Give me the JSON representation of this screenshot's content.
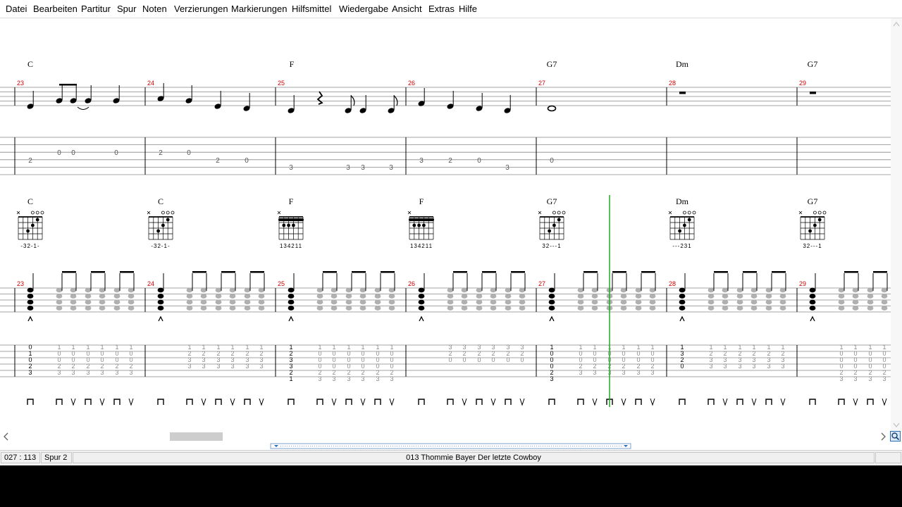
{
  "menu": [
    "Datei",
    "Bearbeiten",
    "Partitur",
    "Spur",
    "Noten",
    "Verzierungen",
    "Markierungen",
    "Hilfsmittel",
    "Wiedergabe",
    "Ansicht",
    "Extras",
    "Hilfe"
  ],
  "system1": {
    "chords": [
      "C",
      "F",
      "G7",
      "Dm",
      "G7"
    ],
    "measures": [
      "23",
      "24",
      "25",
      "26",
      "27",
      "28",
      "29"
    ],
    "tab_numbers": [
      "2",
      "0",
      "0",
      "0",
      "2",
      "0",
      "2",
      "0",
      "3",
      "3",
      "3",
      "3",
      "3",
      "2",
      "0",
      "3",
      "0"
    ]
  },
  "system2": {
    "chords": [
      "C",
      "C",
      "F",
      "F",
      "G7",
      "Dm",
      "G7"
    ],
    "fingerings": [
      "-32-1-",
      "-32-1-",
      "134211",
      "134211",
      "32---1",
      "---231",
      "32---1"
    ],
    "measures": [
      "23",
      "24",
      "25",
      "26",
      "27",
      "28",
      "29"
    ],
    "tab_columns": [
      [
        "0",
        "1",
        "0",
        "2",
        "3"
      ],
      [
        "1",
        "2",
        "3",
        "3",
        "2",
        "1"
      ],
      [
        "1",
        "0",
        "0",
        "0",
        "2",
        "3"
      ],
      [
        "1",
        "3",
        "2",
        "0"
      ]
    ]
  },
  "status": {
    "position": "027 : 113",
    "track": "Spur 2",
    "song": "013  Thommie Bayer   Der letzte Cowboy"
  },
  "colors": {
    "measure_number": "#d00000",
    "playback_cursor": "#22aa22",
    "note_light": "#b0b0b0"
  },
  "icons": [
    "arrow-left-icon",
    "arrow-right-icon",
    "arrow-up-icon",
    "arrow-down-icon",
    "zoom-icon"
  ]
}
